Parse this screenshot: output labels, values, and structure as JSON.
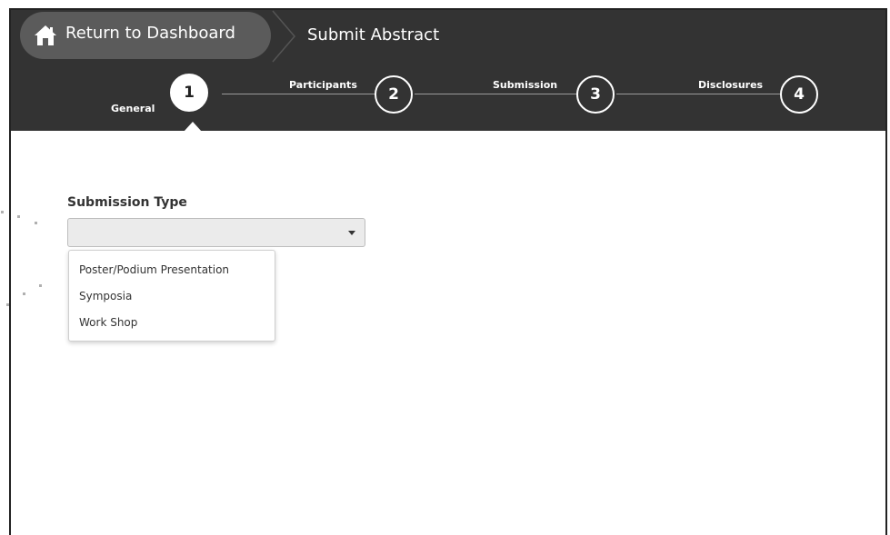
{
  "header": {
    "home_label": "Return to Dashboard",
    "page_title": "Submit Abstract"
  },
  "steps": [
    {
      "number": "1",
      "label": "General",
      "active": true
    },
    {
      "number": "2",
      "label": "Participants",
      "active": false
    },
    {
      "number": "3",
      "label": "Submission",
      "active": false
    },
    {
      "number": "4",
      "label": "Disclosures",
      "active": false
    }
  ],
  "form": {
    "submission_type_label": "Submission Type",
    "submission_type_value": "",
    "options": [
      "Poster/Podium Presentation",
      "Symposia",
      "Work Shop"
    ]
  },
  "icons": {
    "home": "home-icon",
    "select_caret": "caret-down-icon"
  },
  "colors": {
    "header_bg": "#333333",
    "home_button_bg": "#5b5b5b",
    "select_bg": "#ebebeb"
  }
}
